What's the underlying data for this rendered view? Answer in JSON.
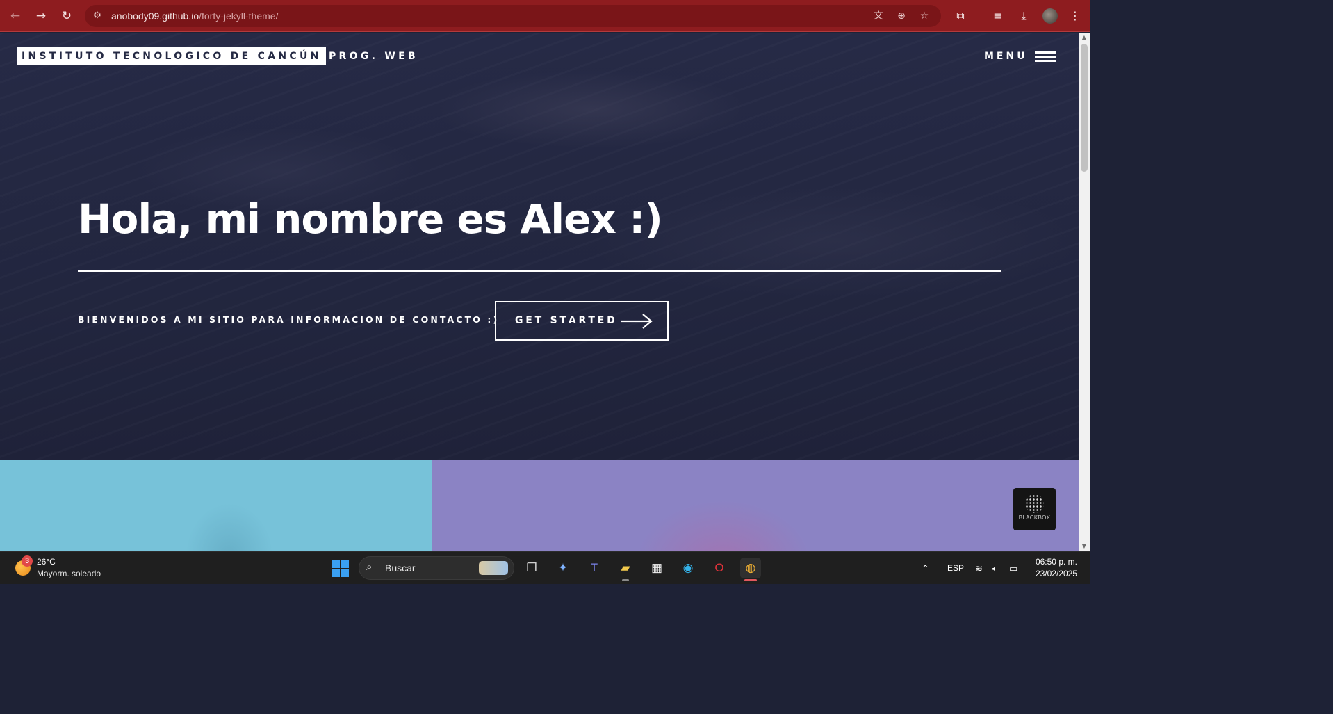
{
  "browser": {
    "url_host": "anobody09.github.io",
    "url_path": "/forty-jekyll-theme/",
    "nav": {
      "back_icon": "←",
      "forward_icon": "→",
      "reload_icon": "↻"
    }
  },
  "site": {
    "brand": "INSTITUTO TECNOLOGICO DE CANCÚN",
    "brand_sub": "PROG. WEB",
    "menu_label": "MENU"
  },
  "hero": {
    "title": "Hola, mi nombre es Alex :)",
    "subtitle": "BIENVENIDOS A MI SITIO PARA INFORMACION DE CONTACTO :)",
    "cta_label": "GET STARTED"
  },
  "widget": {
    "label": "BLACKBOX"
  },
  "taskbar": {
    "weather_badge": "3",
    "weather_temp": "26°C",
    "weather_desc": "Mayorm. soleado",
    "search_placeholder": "Buscar",
    "language": "ESP",
    "time": "06:50 p. m.",
    "date": "23/02/2025"
  },
  "colors": {
    "chrome": "#8e1c1f",
    "hero_bg": "#242943",
    "tile_blue": "#77c2d9",
    "tile_purple": "#8b83c4"
  }
}
